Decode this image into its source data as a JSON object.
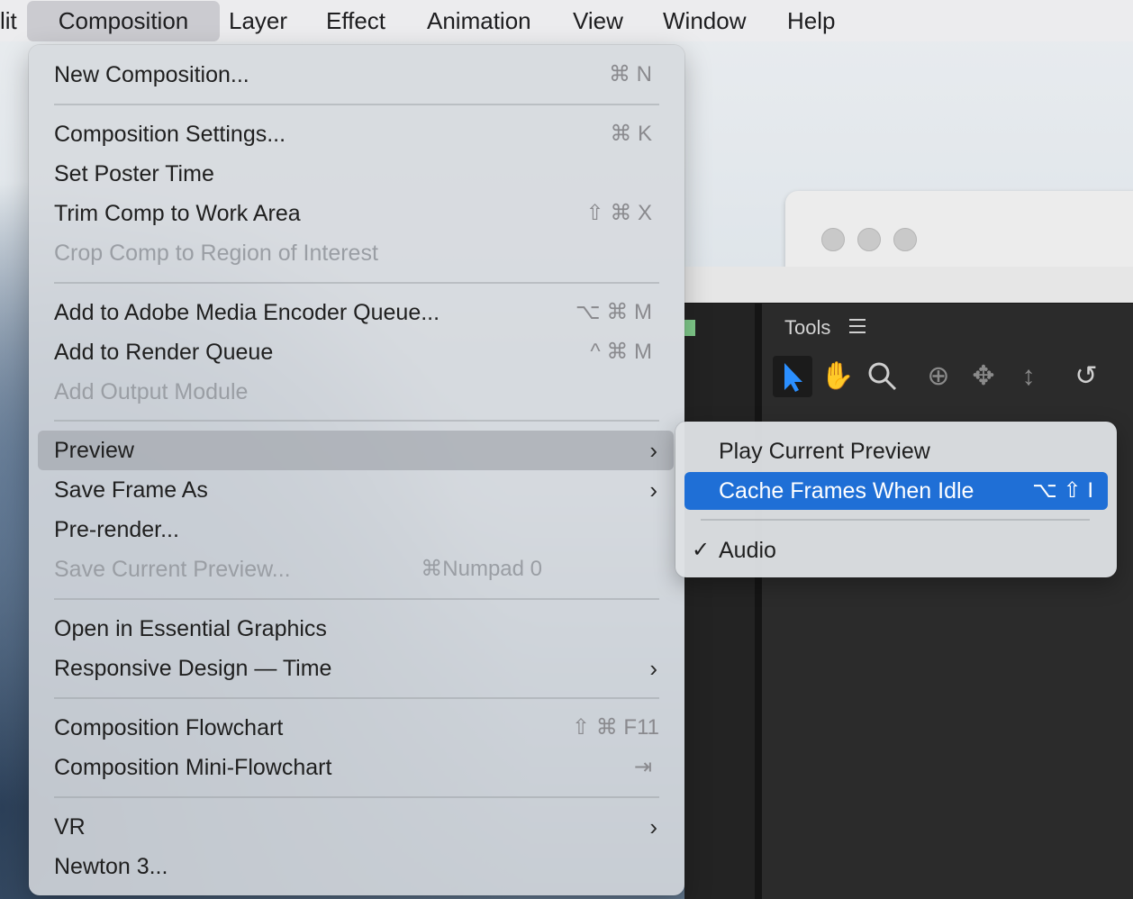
{
  "menubar": {
    "items": [
      "lit",
      "Composition",
      "Layer",
      "Effect",
      "Animation",
      "View",
      "Window",
      "Help"
    ]
  },
  "composition_menu": {
    "new_composition": {
      "label": "New Composition...",
      "shortcut": "⌘ N"
    },
    "composition_settings": {
      "label": "Composition Settings...",
      "shortcut": "⌘ K"
    },
    "set_poster_time": {
      "label": "Set Poster Time"
    },
    "trim_comp": {
      "label": "Trim Comp to Work Area",
      "shortcut": "⇧ ⌘ X"
    },
    "crop_comp": {
      "label": "Crop Comp to Region of Interest"
    },
    "add_media_encoder": {
      "label": "Add to Adobe Media Encoder Queue...",
      "shortcut": "⌥ ⌘ M"
    },
    "add_render_queue": {
      "label": "Add to Render Queue",
      "shortcut": "^ ⌘ M"
    },
    "add_output_module": {
      "label": "Add Output Module"
    },
    "preview": {
      "label": "Preview",
      "arrow": "›"
    },
    "save_frame_as": {
      "label": "Save Frame As",
      "arrow": "›"
    },
    "pre_render": {
      "label": "Pre-render..."
    },
    "save_current_preview": {
      "label": "Save Current Preview...",
      "shortcut": "⌘Numpad 0"
    },
    "open_essential_graphics": {
      "label": "Open in Essential Graphics"
    },
    "responsive_design": {
      "label": "Responsive Design — Time",
      "arrow": "›"
    },
    "composition_flowchart": {
      "label": "Composition Flowchart",
      "shortcut": "⇧ ⌘ F11"
    },
    "composition_mini_flowchart": {
      "label": "Composition Mini-Flowchart",
      "shortcut": "⇥"
    },
    "vr": {
      "label": "VR",
      "arrow": "›"
    },
    "newton": {
      "label": "Newton 3..."
    }
  },
  "preview_submenu": {
    "play_current_preview": {
      "label": "Play Current Preview"
    },
    "cache_frames_when_idle": {
      "label": "Cache Frames When Idle",
      "shortcut": "⌥ ⇧ I"
    },
    "audio": {
      "label": "Audio",
      "check": "✓"
    }
  },
  "tools_panel": {
    "title": "Tools"
  },
  "colors": {
    "highlight": "#1f6fd6",
    "selected_tool": "#2b8fff"
  }
}
